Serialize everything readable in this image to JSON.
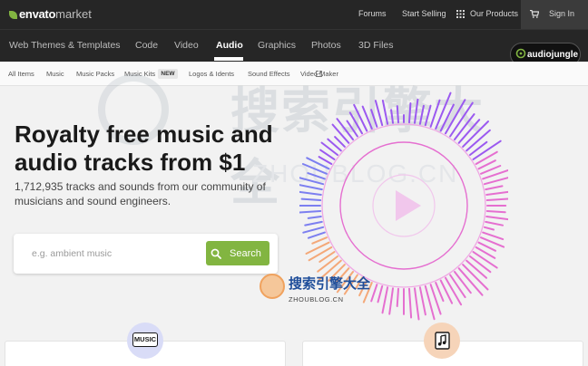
{
  "topbar": {
    "logo_brand": "envato",
    "logo_suffix": "market",
    "links": [
      "Forums",
      "Start Selling",
      "Our Products"
    ],
    "signin": "Sign In"
  },
  "category_nav": {
    "items": [
      "Web Themes & Templates",
      "Code",
      "Video",
      "Audio",
      "Graphics",
      "Photos",
      "3D Files"
    ],
    "active": "Audio",
    "site_badge": "audiojungle"
  },
  "sub_nav": {
    "items": [
      "All Items",
      "Music",
      "Music Packs",
      "Music Kits",
      "Logos & Idents",
      "Sound Effects",
      "Video Maker"
    ],
    "new_badge": "NEW"
  },
  "hero": {
    "headline": "Royalty free music and audio tracks from $1",
    "subhead": "1,712,935 tracks and sounds from our community of musicians and sound engineers.",
    "search_placeholder": "e.g. ambient music",
    "search_button": "Search"
  },
  "watermark": {
    "cn": "搜索引擎大全",
    "en": "ZHOUBLOG.CN"
  },
  "cards": {
    "music_icon_label": "MUSIC"
  },
  "colors": {
    "topbar_bg": "#262626",
    "accent_green": "#82b541",
    "viz_purple": "#9b59f0",
    "viz_pink": "#e56fd0",
    "viz_blue": "#7c7ff0",
    "viz_orange": "#f4a878"
  },
  "icons": {
    "cart": "cart-icon",
    "search": "search-icon",
    "external_link": "external-link-icon",
    "play": "play-icon",
    "audiojungle": "audiojungle-logo-icon",
    "sound_effects": "music-file-icon"
  }
}
